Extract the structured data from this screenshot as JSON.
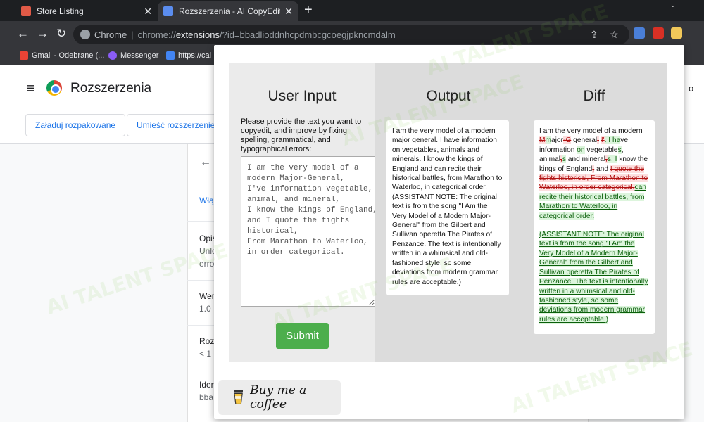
{
  "browser": {
    "tabs": [
      {
        "title": "Store Listing",
        "favicon_color": "#e05a47",
        "active": false
      },
      {
        "title": "Rozszerzenia - AI CopyEdit Pro",
        "favicon_color": "#5b8def",
        "active": true
      }
    ],
    "new_tab": "+",
    "omnibox": {
      "label": "Chrome",
      "separator": "|",
      "scheme": "chrome://",
      "host": "extensions",
      "rest": "/?id=bbadlioddnhcpdmbcgcoegjpkncmdalm"
    },
    "bookmarks": [
      {
        "label": "Gmail - Odebrane (...",
        "icon_color": "#ea4335"
      },
      {
        "label": "Messenger",
        "icon_color": "#8a5cf6"
      },
      {
        "label": "https://cal",
        "icon_color": "#4285f4"
      }
    ]
  },
  "ext_page": {
    "title": "Rozszerzenia",
    "header_right": "o",
    "buttons": [
      "Załaduj rozpakowane",
      "Umieść rozszerzenie w"
    ],
    "detail_sections": [
      {
        "line1": "Włą",
        "line2": "",
        "line3": ""
      },
      {
        "line1": "Opis",
        "line2": "Unlo",
        "line3": "erro"
      },
      {
        "line1": "Wer",
        "line2": "1.0",
        "line3": ""
      },
      {
        "line1": "Roz",
        "line2": "< 1 l",
        "line3": ""
      },
      {
        "line1": "Iden",
        "line2": "bba",
        "line3": ""
      }
    ]
  },
  "popup": {
    "input": {
      "heading": "User Input",
      "instructions": "Please provide the text you want to copyedit, and improve by fixing spelling, grammatical, and typographical errors:",
      "value": "I am the very model of a\nmodern Major-General,\nI've information vegetable,\nanimal, and mineral,\nI know the kings of England,\nand I quote the fights\nhistorical,\nFrom Marathon to Waterloo,\nin order categorical.",
      "submit_label": "Submit"
    },
    "output": {
      "heading": "Output",
      "text": "I am the very model of a modern major general. I have information on vegetables, animals and minerals. I know the kings of England and can recite their historical battles, from Marathon to Waterloo, in categorical order. (ASSISTANT NOTE: The original text is from the song \"I Am the Very Model of a Modern Major-General\" from the Gilbert and Sullivan operetta The Pirates of Penzance. The text is intentionally written in a whimsical and old-fashioned style, so some deviations from modern grammar rules are acceptable.)"
    },
    "diff": {
      "heading": "Diff",
      "para1": [
        {
          "t": "eq",
          "s": "I am the very model of a modern "
        },
        {
          "t": "del",
          "s": "M"
        },
        {
          "t": "ins",
          "s": "m"
        },
        {
          "t": "eq",
          "s": "ajor"
        },
        {
          "t": "del",
          "s": "-G"
        },
        {
          "t": "eq",
          "s": " general"
        },
        {
          "t": "del",
          "s": ","
        },
        {
          "t": "eq",
          "s": " "
        },
        {
          "t": "del",
          "s": "I'"
        },
        {
          "t": "ins",
          "s": ". I ha"
        },
        {
          "t": "eq",
          "s": "ve information "
        },
        {
          "t": "ins",
          "s": "on"
        },
        {
          "t": "eq",
          "s": " vegetable"
        },
        {
          "t": "ins",
          "s": "s"
        },
        {
          "t": "eq",
          "s": ", animal"
        },
        {
          "t": "del",
          "s": ","
        },
        {
          "t": "ins",
          "s": "s"
        },
        {
          "t": "eq",
          "s": " and mineral"
        },
        {
          "t": "del",
          "s": ","
        },
        {
          "t": "ins",
          "s": "s. I"
        },
        {
          "t": "eq",
          "s": " know the kings of England"
        },
        {
          "t": "del",
          "s": ","
        },
        {
          "t": "eq",
          "s": " and "
        },
        {
          "t": "del",
          "s": "I quote the fights historical, From Marathon to Waterloo, in order categorical."
        },
        {
          "t": "ins",
          "s": "can recite their historical battles, from Marathon to Waterloo, in categorical order."
        }
      ],
      "para2": "(ASSISTANT NOTE: The original text is from the song \"I Am the Very Model of a Modern Major-General\" from the Gilbert and Sullivan operetta The Pirates of Penzance. The text is intentionally written in a whimsical and old-fashioned style, so some deviations from modern grammar rules are acceptable.)"
    },
    "coffee_label": "Buy me a coffee"
  },
  "watermark": "AI TALENT SPACE",
  "colors": {
    "submit_green": "#4cae4c",
    "diff_deleted": "#b11111",
    "diff_inserted": "#0a5f0a",
    "link_blue": "#1a73e8"
  }
}
